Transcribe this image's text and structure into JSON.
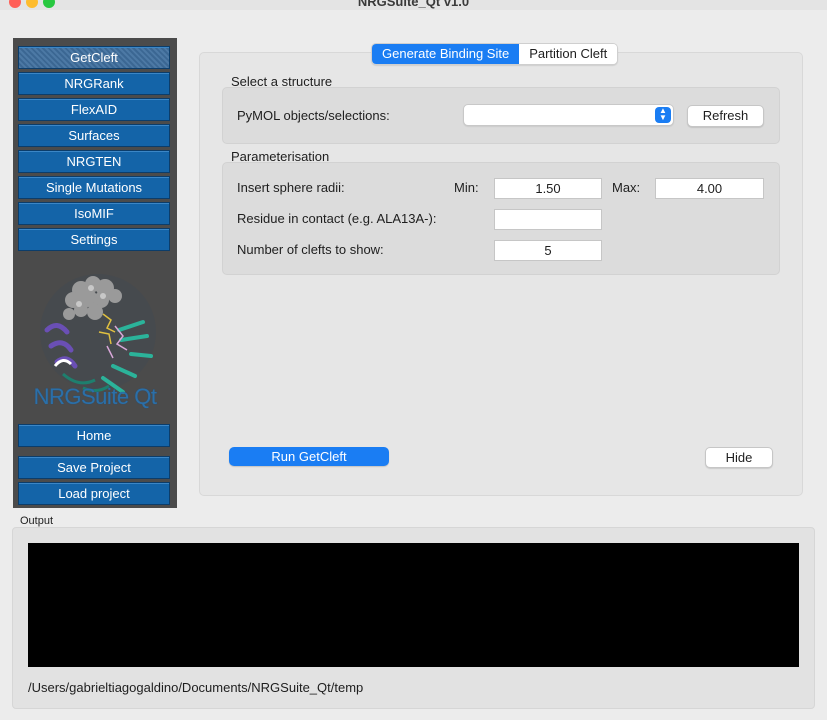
{
  "window": {
    "title": "NRGSuite_Qt v1.0",
    "traffic_lights": [
      "#ff5f57",
      "#febc2e",
      "#28c840"
    ]
  },
  "sidebar": {
    "items": [
      {
        "label": "GetCleft"
      },
      {
        "label": "NRGRank"
      },
      {
        "label": "FlexAID"
      },
      {
        "label": "Surfaces"
      },
      {
        "label": "NRGTEN"
      },
      {
        "label": "Single Mutations"
      },
      {
        "label": "IsoMIF"
      },
      {
        "label": "Settings"
      }
    ],
    "logo_text": "NRGSuite Qt",
    "home_label": "Home",
    "save_label": "Save Project",
    "load_label": "Load project"
  },
  "tabs": [
    {
      "label": "Generate Binding Site"
    },
    {
      "label": "Partition Cleft"
    }
  ],
  "structure": {
    "title": "Select a structure",
    "label": "PyMOL objects/selections:",
    "selected": "",
    "refresh_label": "Refresh"
  },
  "params": {
    "title": "Parameterisation",
    "radii_label": "Insert sphere radii:",
    "min_label": "Min:",
    "min_value": "1.50",
    "max_label": "Max:",
    "max_value": "4.00",
    "residue_label": "Residue in contact (e.g. ALA13A-):",
    "residue_value": "",
    "clefts_label": "Number of clefts to show:",
    "clefts_value": "5"
  },
  "actions": {
    "run_label": "Run GetCleft",
    "hide_label": "Hide"
  },
  "output": {
    "label": "Output",
    "path": "/Users/gabrieltiagogaldino/Documents/NRGSuite_Qt/temp"
  },
  "colors": {
    "accent": "#1a7df3",
    "sidebar_button": "#1464a8",
    "sidebar_bg": "#4b4b4b"
  }
}
